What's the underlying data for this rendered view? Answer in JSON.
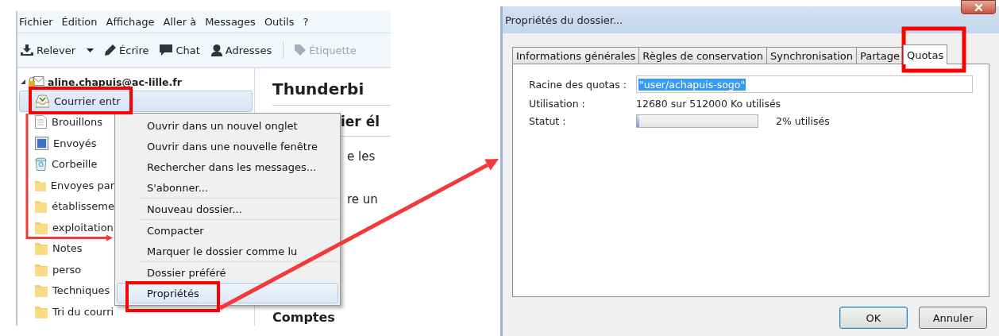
{
  "mail_window": {
    "menu_bar": [
      "Fichier",
      "Édition",
      "Affichage",
      "Aller à",
      "Messages",
      "Outils",
      "?"
    ],
    "toolbar": [
      {
        "kind": "get",
        "label": "Relever",
        "disabled": false
      },
      {
        "kind": "dropdown",
        "disabled": false
      },
      {
        "kind": "write",
        "label": "Écrire",
        "disabled": false
      },
      {
        "kind": "chat",
        "label": "Chat",
        "disabled": false
      },
      {
        "kind": "contacts",
        "label": "Adresses",
        "disabled": false
      },
      {
        "kind": "separator"
      },
      {
        "kind": "tag",
        "label": "Étiquette",
        "disabled": true
      }
    ],
    "account": "aline.chapuis@ac-lille.fr",
    "folders": [
      {
        "kind": "inbox",
        "name": "Courrier entr",
        "selected": true
      },
      {
        "kind": "drafts",
        "name": "Brouillons",
        "selected": false
      },
      {
        "kind": "sent",
        "name": "Envoyés",
        "selected": false
      },
      {
        "kind": "trash",
        "name": "Corbeille",
        "selected": false
      },
      {
        "kind": "folder",
        "name": "Envoyes par",
        "selected": false
      },
      {
        "kind": "folder",
        "name": "établisseme",
        "selected": false
      },
      {
        "kind": "folder",
        "name": "exploitation",
        "selected": false
      },
      {
        "kind": "folder",
        "name": "Notes",
        "selected": false
      },
      {
        "kind": "folder",
        "name": "perso",
        "selected": false
      },
      {
        "kind": "folder",
        "name": "Techniques",
        "selected": false
      },
      {
        "kind": "folder",
        "name": "Tri du courri",
        "selected": false
      }
    ],
    "content": {
      "heading": "Thunderbi",
      "subheading": "ier él",
      "lines": [
        "e les",
        "re un"
      ],
      "section": "Comptes"
    },
    "context_menu": [
      [
        {
          "label": "Ouvrir dans un nouvel onglet",
          "selected": false
        },
        {
          "label": "Ouvrir dans une nouvelle fenêtre",
          "selected": false
        },
        {
          "label": "Rechercher dans les messages...",
          "selected": false
        },
        {
          "label": "S'abonner...",
          "selected": false
        }
      ],
      [
        {
          "label": "Nouveau dossier...",
          "selected": false
        }
      ],
      [
        {
          "label": "Compacter",
          "selected": false
        },
        {
          "label": "Marquer le dossier comme lu",
          "selected": false
        }
      ],
      [
        {
          "label": "Dossier préféré",
          "selected": false
        },
        {
          "label": "Propriétés",
          "selected": true
        }
      ]
    ]
  },
  "dialog": {
    "title": "Propriétés du dossier...",
    "tabs": [
      {
        "label": "Informations générales",
        "selected": false
      },
      {
        "label": "Règles de conservation",
        "selected": false
      },
      {
        "label": "Synchronisation",
        "selected": false
      },
      {
        "label": "Partage",
        "selected": false
      },
      {
        "label": "Quotas",
        "selected": true
      }
    ],
    "quota_root": {
      "label": "Racine des quotas :",
      "value": "\"user/achapuis-sogo\""
    },
    "usage": {
      "label": "Utilisation :",
      "value": "12680 sur 512000 Ko utilisés"
    },
    "status": {
      "label": "Statut :",
      "level": 0.02,
      "reading": "2% utilisés"
    },
    "buttons": [
      {
        "label": "OK",
        "default": true
      },
      {
        "label": "Annuler",
        "default": false
      }
    ]
  }
}
